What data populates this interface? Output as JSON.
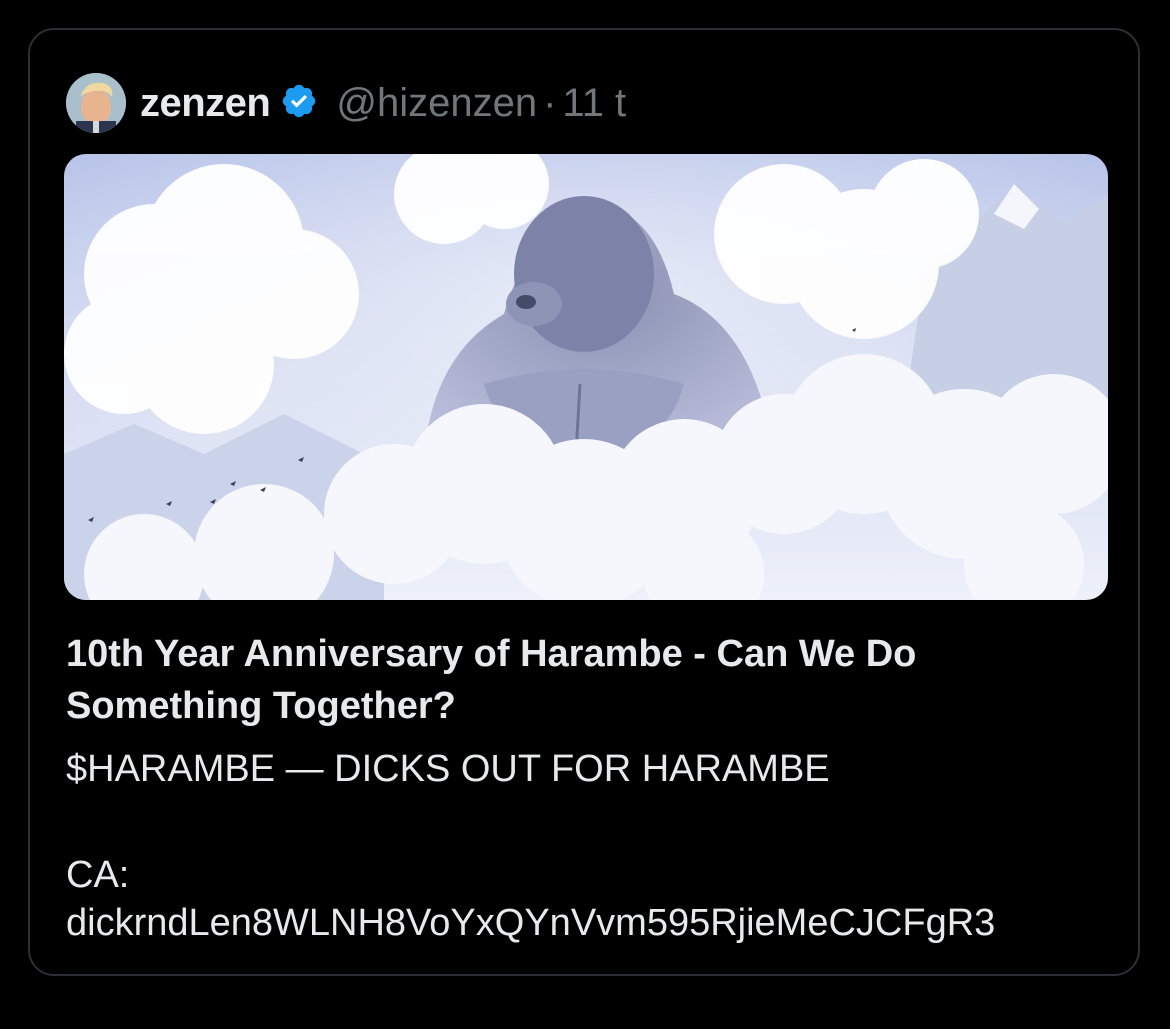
{
  "post": {
    "display_name": "zenzen",
    "handle": "@hizenzen",
    "separator": "·",
    "age": "11 t",
    "verified_color": "#1d9bf0",
    "avatar_icon": "user-avatar-icon",
    "verified_icon": "verified-badge-icon"
  },
  "card": {
    "media_icon": "harambe-clouds-image",
    "title": "10th Year Anniversary of Harambe - Can We Do Something Together?",
    "subtitle": "$HARAMBE — DICKS OUT FOR HARAMBE",
    "ca_label": "CA:",
    "ca_value": "dickrndLen8WLNH8VoYxQYnVvm595RjieMeCJCFgR3"
  }
}
